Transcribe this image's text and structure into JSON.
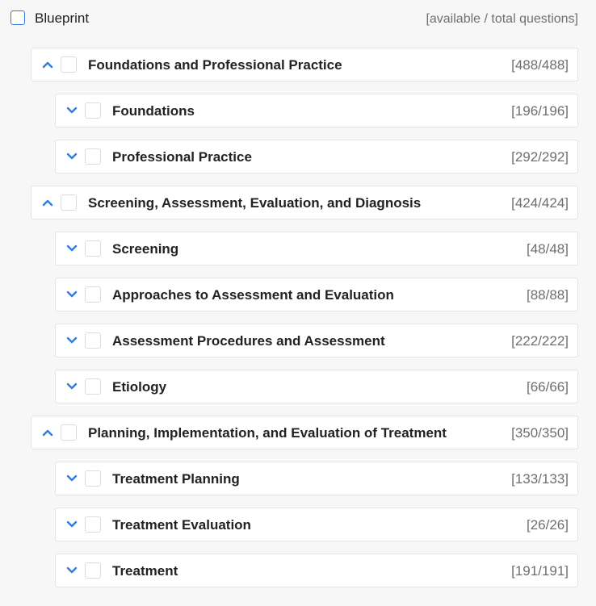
{
  "root": {
    "title": "Blueprint",
    "meta": "[available / total questions]"
  },
  "colors": {
    "accent": "#2f7de1",
    "background": "#f7f7f7",
    "card": "#ffffff",
    "border": "#e3e3e3",
    "count_text": "#6e6e6e"
  },
  "icons": {
    "expanded": "chevron-up-icon",
    "collapsed": "chevron-down-icon"
  },
  "categories": [
    {
      "label": "Foundations and Professional Practice",
      "count": "[488/488]",
      "expanded": true,
      "children": [
        {
          "label": "Foundations",
          "count": "[196/196]",
          "expanded": false
        },
        {
          "label": "Professional Practice",
          "count": "[292/292]",
          "expanded": false
        }
      ]
    },
    {
      "label": "Screening, Assessment, Evaluation, and Diagnosis",
      "count": "[424/424]",
      "expanded": true,
      "children": [
        {
          "label": "Screening",
          "count": "[48/48]",
          "expanded": false
        },
        {
          "label": "Approaches to Assessment and Evaluation",
          "count": "[88/88]",
          "expanded": false
        },
        {
          "label": "Assessment Procedures and Assessment",
          "count": "[222/222]",
          "expanded": false
        },
        {
          "label": "Etiology",
          "count": "[66/66]",
          "expanded": false
        }
      ]
    },
    {
      "label": "Planning, Implementation, and Evaluation of Treatment",
      "count": "[350/350]",
      "expanded": true,
      "children": [
        {
          "label": "Treatment Planning",
          "count": "[133/133]",
          "expanded": false
        },
        {
          "label": "Treatment Evaluation",
          "count": "[26/26]",
          "expanded": false
        },
        {
          "label": "Treatment",
          "count": "[191/191]",
          "expanded": false
        }
      ]
    }
  ]
}
